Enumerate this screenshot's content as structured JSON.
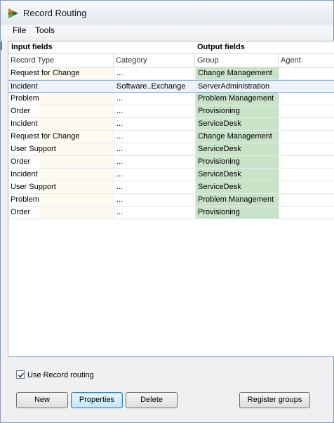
{
  "window": {
    "title": "Record Routing"
  },
  "menu": [
    {
      "label": "File"
    },
    {
      "label": "Tools"
    }
  ],
  "table": {
    "input_header": "Input fields",
    "output_header": "Output fields",
    "columns": [
      "Record Type",
      "Category",
      "Group",
      "Agent"
    ],
    "rows": [
      {
        "type": "Request for Change",
        "category": "...",
        "group": "Change Management",
        "agent": ""
      },
      {
        "type": "Incident",
        "category": "Software..Exchange",
        "group": "ServerAdministration",
        "agent": ""
      },
      {
        "type": "Problem",
        "category": "...",
        "group": "Problem Management",
        "agent": ""
      },
      {
        "type": "Order",
        "category": "...",
        "group": "Provisioning",
        "agent": ""
      },
      {
        "type": "Incident",
        "category": "...",
        "group": "ServiceDesk",
        "agent": ""
      },
      {
        "type": "Request for Change",
        "category": "...",
        "group": "Change Management",
        "agent": ""
      },
      {
        "type": "User Support",
        "category": "...",
        "group": "ServiceDesk",
        "agent": ""
      },
      {
        "type": "Order",
        "category": "...",
        "group": "Provisioning",
        "agent": ""
      },
      {
        "type": "Incident",
        "category": "...",
        "group": "ServiceDesk",
        "agent": ""
      },
      {
        "type": "User Support",
        "category": "...",
        "group": "ServiceDesk",
        "agent": ""
      },
      {
        "type": "Problem",
        "category": "...",
        "group": "Problem Management",
        "agent": ""
      },
      {
        "type": "Order",
        "category": "...",
        "group": "Provisioning",
        "agent": ""
      }
    ]
  },
  "use_routing": {
    "label": "Use Record routing",
    "checked": true
  },
  "buttons": {
    "new": "New",
    "properties": "Properties",
    "delete": "Delete",
    "register_groups": "Register groups"
  },
  "colors": {
    "output_group_bg": "#c9e3c8",
    "input_type_bg": "#fffaf0",
    "selected_row": "#eef3fb"
  }
}
